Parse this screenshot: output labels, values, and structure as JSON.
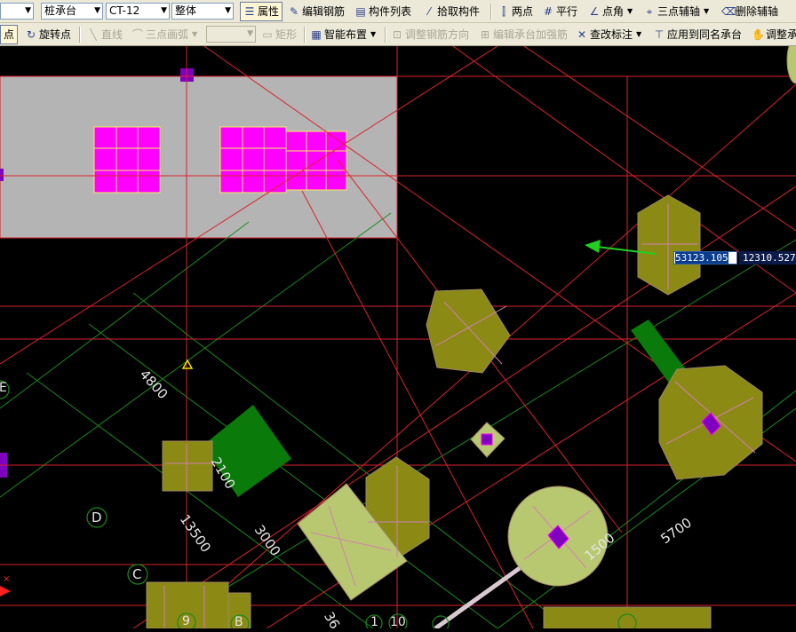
{
  "toolbar_row1": {
    "category_select": "桩承台",
    "component_select": "CT-12",
    "scope_select": "整体",
    "properties_label": "属性",
    "edit_rebar_label": "编辑钢筋",
    "component_list_label": "构件列表",
    "pick_component_label": "拾取构件",
    "two_points_label": "两点",
    "parallel_label": "平行",
    "point_angle_label": "点角",
    "three_point_axis_label": "三点辅轴",
    "delete_axis_label": "删除辅轴"
  },
  "toolbar_row2": {
    "point_label": "点",
    "rotate_point_label": "旋转点",
    "line_label": "直线",
    "arc_label": "三点画弧",
    "rect_label": "矩形",
    "smart_layout_label": "智能布置",
    "adjust_rebar_dir_label": "调整钢筋方向",
    "edit_cap_rebar_label": "编辑承台加强筋",
    "check_annotation_label": "查改标注",
    "apply_same_cap_label": "应用到同名承台",
    "adjust_label": "调整承"
  },
  "canvas": {
    "dimensions": [
      "4800",
      "2100",
      "13500",
      "3000",
      "1500",
      "5700",
      "36"
    ],
    "axis_labels": [
      "E",
      "D",
      "C",
      "B",
      "9",
      "1",
      "10"
    ],
    "coord_input_x": "53123.105",
    "coord_input_y": "12310.527"
  },
  "colors": {
    "background": "#000000",
    "grid_red": "#d8242c",
    "grid_green": "#1b8a1b",
    "pile_cap_olive": "#8a8a14",
    "pile_cap_light": "#b8c870",
    "column_magenta": "#ff00ff",
    "beam_green": "#0a7a0a",
    "slab_gray": "#b4b4b4"
  }
}
